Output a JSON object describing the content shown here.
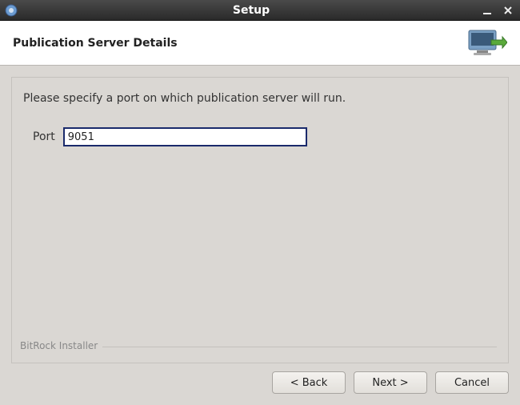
{
  "titlebar": {
    "title": "Setup"
  },
  "header": {
    "title": "Publication Server Details"
  },
  "content": {
    "instruction": "Please specify a port on which publication server will run.",
    "port_label": "Port",
    "port_value": "9051",
    "footer_legend": "BitRock Installer"
  },
  "buttons": {
    "back": "< Back",
    "next": "Next >",
    "cancel": "Cancel"
  }
}
